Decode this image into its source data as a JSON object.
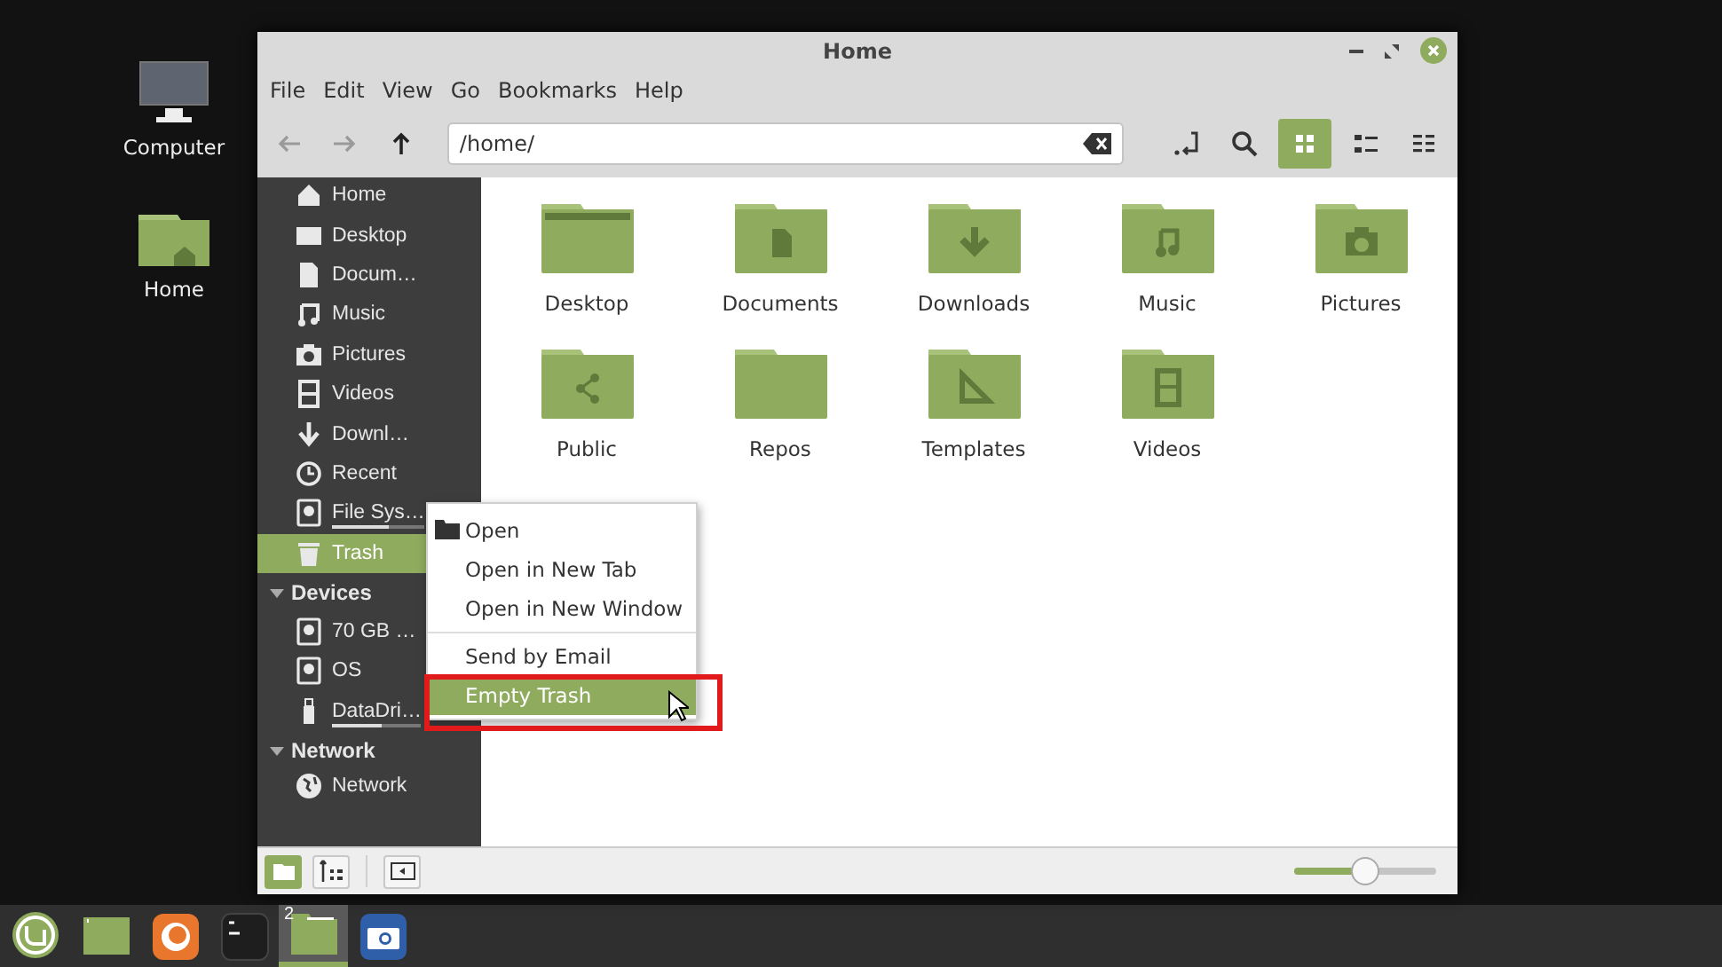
{
  "desktop_icons": [
    {
      "kind": "computer",
      "label": "Computer"
    },
    {
      "kind": "home",
      "label": "Home"
    }
  ],
  "window": {
    "title": "Home",
    "menu": [
      "File",
      "Edit",
      "View",
      "Go",
      "Bookmarks",
      "Help"
    ],
    "toolbar": {
      "nav": [
        {
          "kind": "back",
          "disabled": true
        },
        {
          "kind": "forward",
          "disabled": true
        },
        {
          "kind": "up",
          "disabled": false
        }
      ],
      "location": "/home/",
      "views": [
        {
          "kind": "icons",
          "selected": true
        },
        {
          "kind": "list",
          "selected": false
        },
        {
          "kind": "compact",
          "selected": false
        }
      ]
    },
    "sidebar": {
      "places": [
        {
          "kind": "home",
          "label": "Home",
          "selected": false
        },
        {
          "kind": "desktop",
          "label": "Desktop",
          "selected": false
        },
        {
          "kind": "document",
          "label": "Docum…",
          "selected": false
        },
        {
          "kind": "music",
          "label": "Music",
          "selected": false
        },
        {
          "kind": "pictures",
          "label": "Pictures",
          "selected": false
        },
        {
          "kind": "videos",
          "label": "Videos",
          "selected": false
        },
        {
          "kind": "download",
          "label": "Downl…",
          "selected": false
        },
        {
          "kind": "recent",
          "label": "Recent",
          "selected": false
        },
        {
          "kind": "drive",
          "label": "File Sys…",
          "selected": false,
          "level": 0.62
        },
        {
          "kind": "trash",
          "label": "Trash",
          "selected": true
        }
      ],
      "sections": [
        {
          "title": "Devices",
          "expanded": true,
          "items": [
            {
              "kind": "drive",
              "label": "70 GB …",
              "selected": false
            },
            {
              "kind": "drive",
              "label": "OS",
              "selected": false
            },
            {
              "kind": "usb",
              "label": "DataDri…",
              "selected": false,
              "level": 0.55
            }
          ]
        },
        {
          "title": "Network",
          "expanded": true,
          "items": [
            {
              "kind": "network",
              "label": "Network",
              "selected": false
            }
          ]
        }
      ]
    },
    "files": [
      {
        "kind": "desktop",
        "name": "Desktop"
      },
      {
        "kind": "documents",
        "name": "Documents"
      },
      {
        "kind": "downloads",
        "name": "Downloads"
      },
      {
        "kind": "music",
        "name": "Music"
      },
      {
        "kind": "pictures",
        "name": "Pictures"
      },
      {
        "kind": "public",
        "name": "Public"
      },
      {
        "kind": "plain",
        "name": "Repos"
      },
      {
        "kind": "templates",
        "name": "Templates"
      },
      {
        "kind": "videos",
        "name": "Videos"
      }
    ],
    "context_menu": {
      "items": [
        {
          "kind": "icon_item",
          "label": "Open",
          "selected": false,
          "annotated": false
        },
        {
          "kind": "item",
          "label": "Open in New Tab",
          "selected": false,
          "annotated": false
        },
        {
          "kind": "item",
          "label": "Open in New Window",
          "selected": false,
          "annotated": false
        },
        {
          "kind": "separator"
        },
        {
          "kind": "item",
          "label": "Send by Email",
          "selected": false,
          "annotated": false
        },
        {
          "kind": "item",
          "label": "Empty Trash",
          "selected": true,
          "annotated": true
        }
      ]
    },
    "status_bar": {
      "buttons": [
        {
          "kind": "places",
          "selected": true
        },
        {
          "kind": "tree",
          "selected": false
        },
        {
          "kind": "sidebar",
          "selected": false
        }
      ],
      "zoom": {
        "level": 0.5
      }
    }
  },
  "taskbar": {
    "items": [
      {
        "kind": "menu",
        "active": false
      },
      {
        "kind": "desktop",
        "active": false
      },
      {
        "kind": "browser",
        "active": false
      },
      {
        "kind": "terminal",
        "active": false
      },
      {
        "kind": "files",
        "active": true,
        "badge": "2"
      },
      {
        "kind": "camera",
        "active": false
      }
    ]
  }
}
